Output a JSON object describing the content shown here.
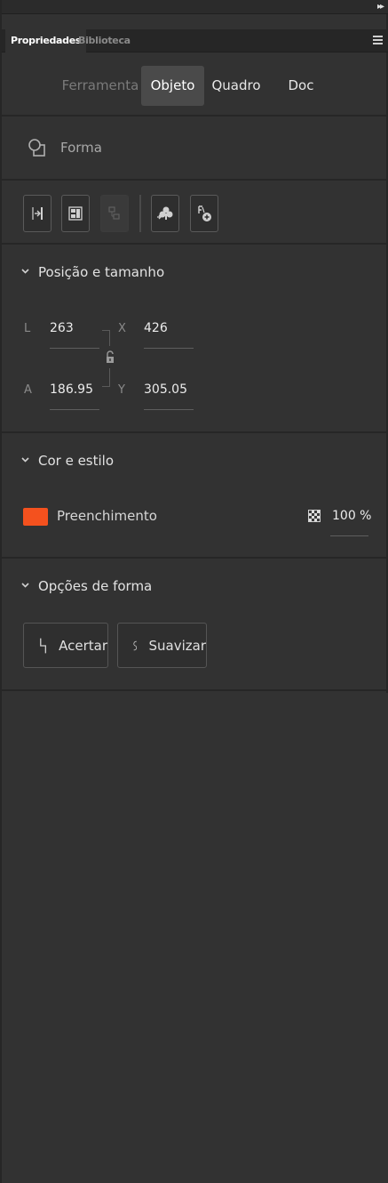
{
  "panel_tabs": [
    {
      "label": "Propriedades",
      "active": true
    },
    {
      "label": "Biblioteca",
      "active": false
    }
  ],
  "subtabs": [
    {
      "label": "Ferramenta",
      "state": "disabled"
    },
    {
      "label": "Objeto",
      "state": "active"
    },
    {
      "label": "Quadro",
      "state": "normal"
    },
    {
      "label": "Doc",
      "state": "normal"
    }
  ],
  "object_type": {
    "label": "Forma",
    "icon": "shape-icon"
  },
  "toolbar": {
    "buttons": [
      {
        "icon": "align-right-icon",
        "enabled": true
      },
      {
        "icon": "distribute-icon",
        "enabled": true
      },
      {
        "icon": "group-icon",
        "enabled": false
      },
      {
        "icon": "convert-symbol-icon",
        "enabled": true
      },
      {
        "icon": "add-motion-icon",
        "enabled": true
      }
    ]
  },
  "position_size": {
    "header": "Posição e tamanho",
    "width_letter": "L",
    "width": "263",
    "x_letter": "X",
    "x": "426",
    "height_letter": "A",
    "height": "186.95",
    "y_letter": "Y",
    "y": "305.05",
    "lock_icon": "unlock-icon"
  },
  "color_style": {
    "header": "Cor e estilo",
    "fill_label": "Preenchimento",
    "fill_color": "#F4511E",
    "opacity": "100 %"
  },
  "shape_options": {
    "header": "Opções de forma",
    "straighten_label": "Acertar",
    "smooth_label": "Suavizar"
  }
}
